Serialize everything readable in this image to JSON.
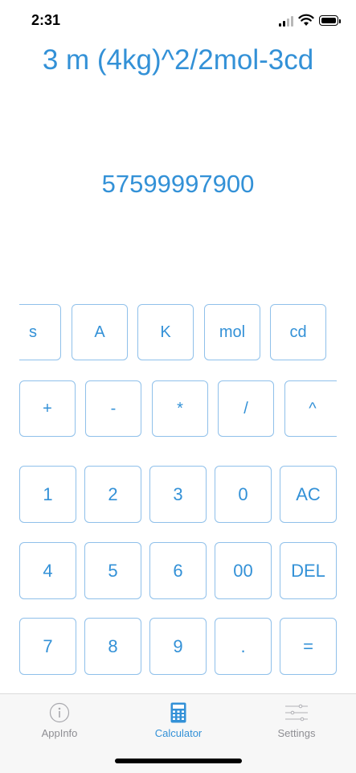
{
  "status": {
    "time": "2:31"
  },
  "display": {
    "expression": "3 m (4kg)^2/2mol-3cd",
    "result": "57599997900"
  },
  "keys": {
    "units": [
      "s",
      "A",
      "K",
      "mol",
      "cd"
    ],
    "operators": [
      "+",
      "-",
      "*",
      "/",
      "^"
    ],
    "row1": [
      "1",
      "2",
      "3",
      "0",
      "AC"
    ],
    "row2": [
      "4",
      "5",
      "6",
      "00",
      "DEL"
    ],
    "row3": [
      "7",
      "8",
      "9",
      ".",
      "="
    ]
  },
  "tabs": [
    {
      "label": "AppInfo",
      "icon": "info-icon"
    },
    {
      "label": "Calculator",
      "icon": "calculator-icon"
    },
    {
      "label": "Settings",
      "icon": "sliders-icon"
    }
  ],
  "colors": {
    "accent": "#3391d7",
    "key_border": "#8fc0ea",
    "inactive": "#8e8e93"
  }
}
